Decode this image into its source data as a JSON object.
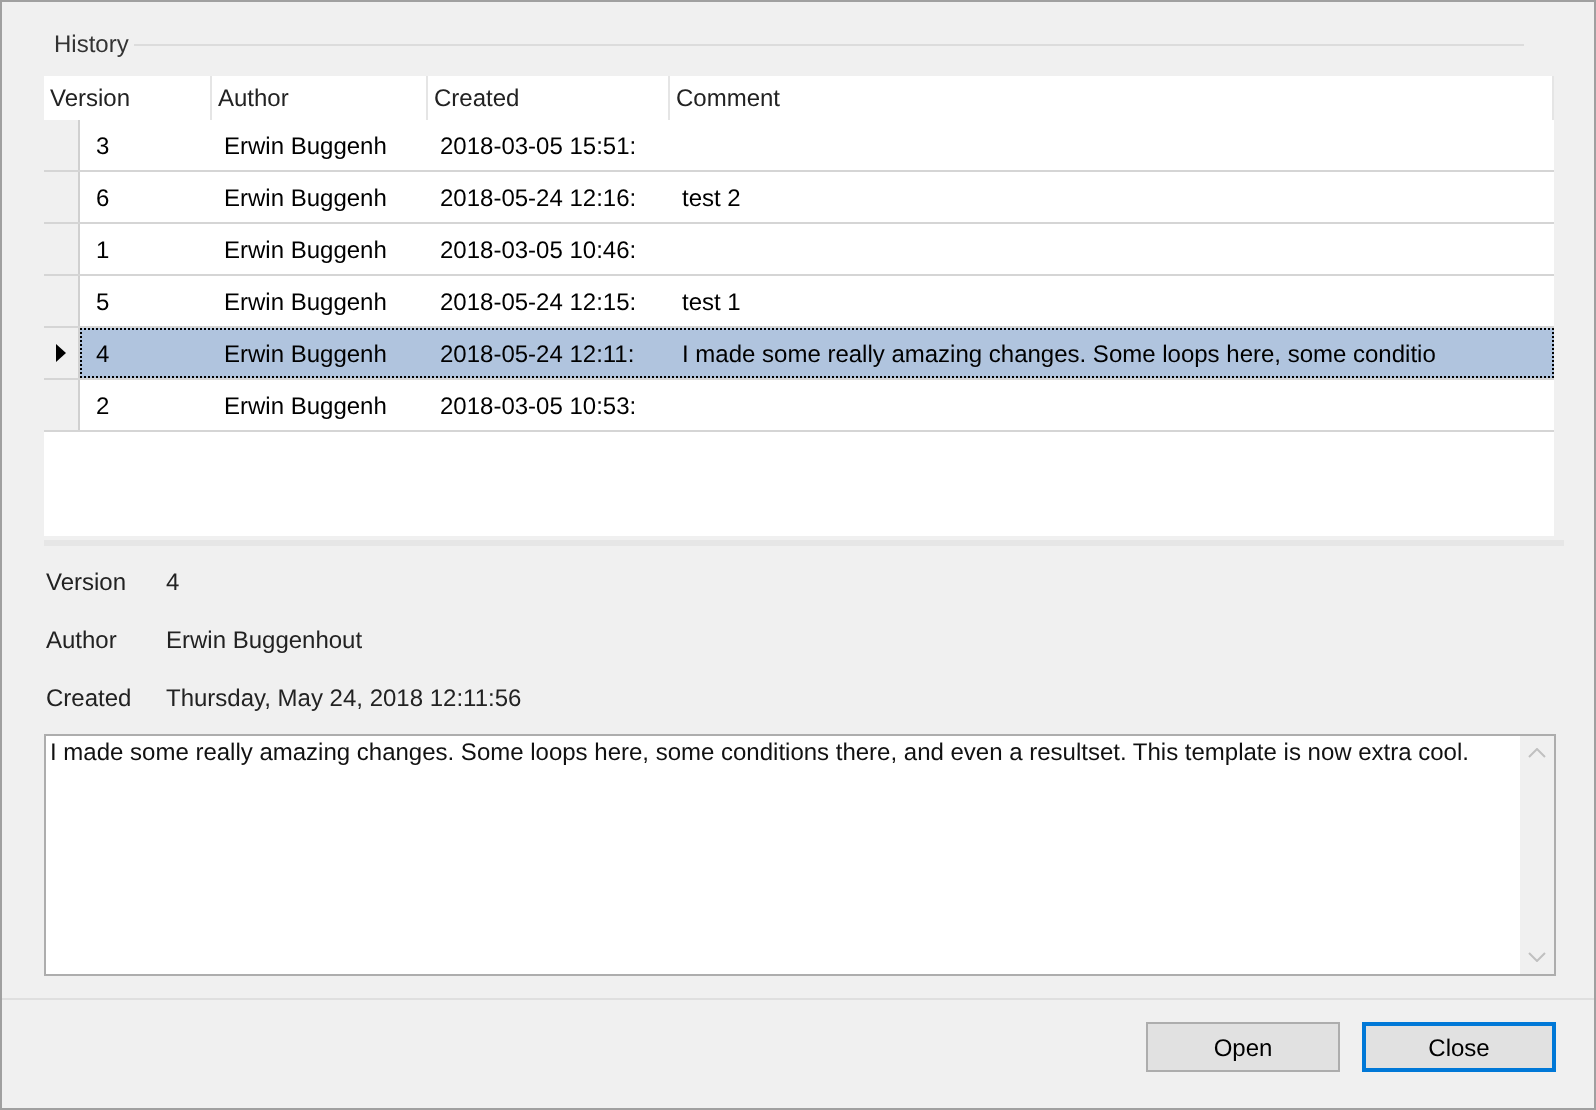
{
  "history": {
    "title": "History",
    "columns": [
      "Version",
      "Author",
      "Created",
      "Comment"
    ],
    "rows": [
      {
        "version": "3",
        "author": "Erwin Buggenh",
        "created": "2018-03-05 15:51:",
        "comment": "",
        "selected": false
      },
      {
        "version": "6",
        "author": "Erwin Buggenh",
        "created": "2018-05-24 12:16:",
        "comment": "test 2",
        "selected": false
      },
      {
        "version": "1",
        "author": "Erwin Buggenh",
        "created": "2018-03-05 10:46:",
        "comment": "",
        "selected": false
      },
      {
        "version": "5",
        "author": "Erwin Buggenh",
        "created": "2018-05-24 12:15:",
        "comment": "test 1",
        "selected": false
      },
      {
        "version": "4",
        "author": "Erwin Buggenh",
        "created": "2018-05-24 12:11:",
        "comment": "I made some really amazing changes. Some loops here, some conditio",
        "selected": true
      },
      {
        "version": "2",
        "author": "Erwin Buggenh",
        "created": "2018-03-05 10:53:",
        "comment": "",
        "selected": false
      }
    ]
  },
  "details": [
    {
      "label": "Version",
      "value": "4"
    },
    {
      "label": "Author",
      "value": "Erwin Buggenhout"
    },
    {
      "label": "Created",
      "value": "Thursday, May 24, 2018 12:11:56"
    }
  ],
  "comment_box": {
    "value": "I made some really amazing changes. Some loops here, some conditions there, and even a resultset. This template is now extra cool."
  },
  "buttons": [
    {
      "label": "Open",
      "focused": false
    },
    {
      "label": "Close",
      "focused": true
    }
  ]
}
